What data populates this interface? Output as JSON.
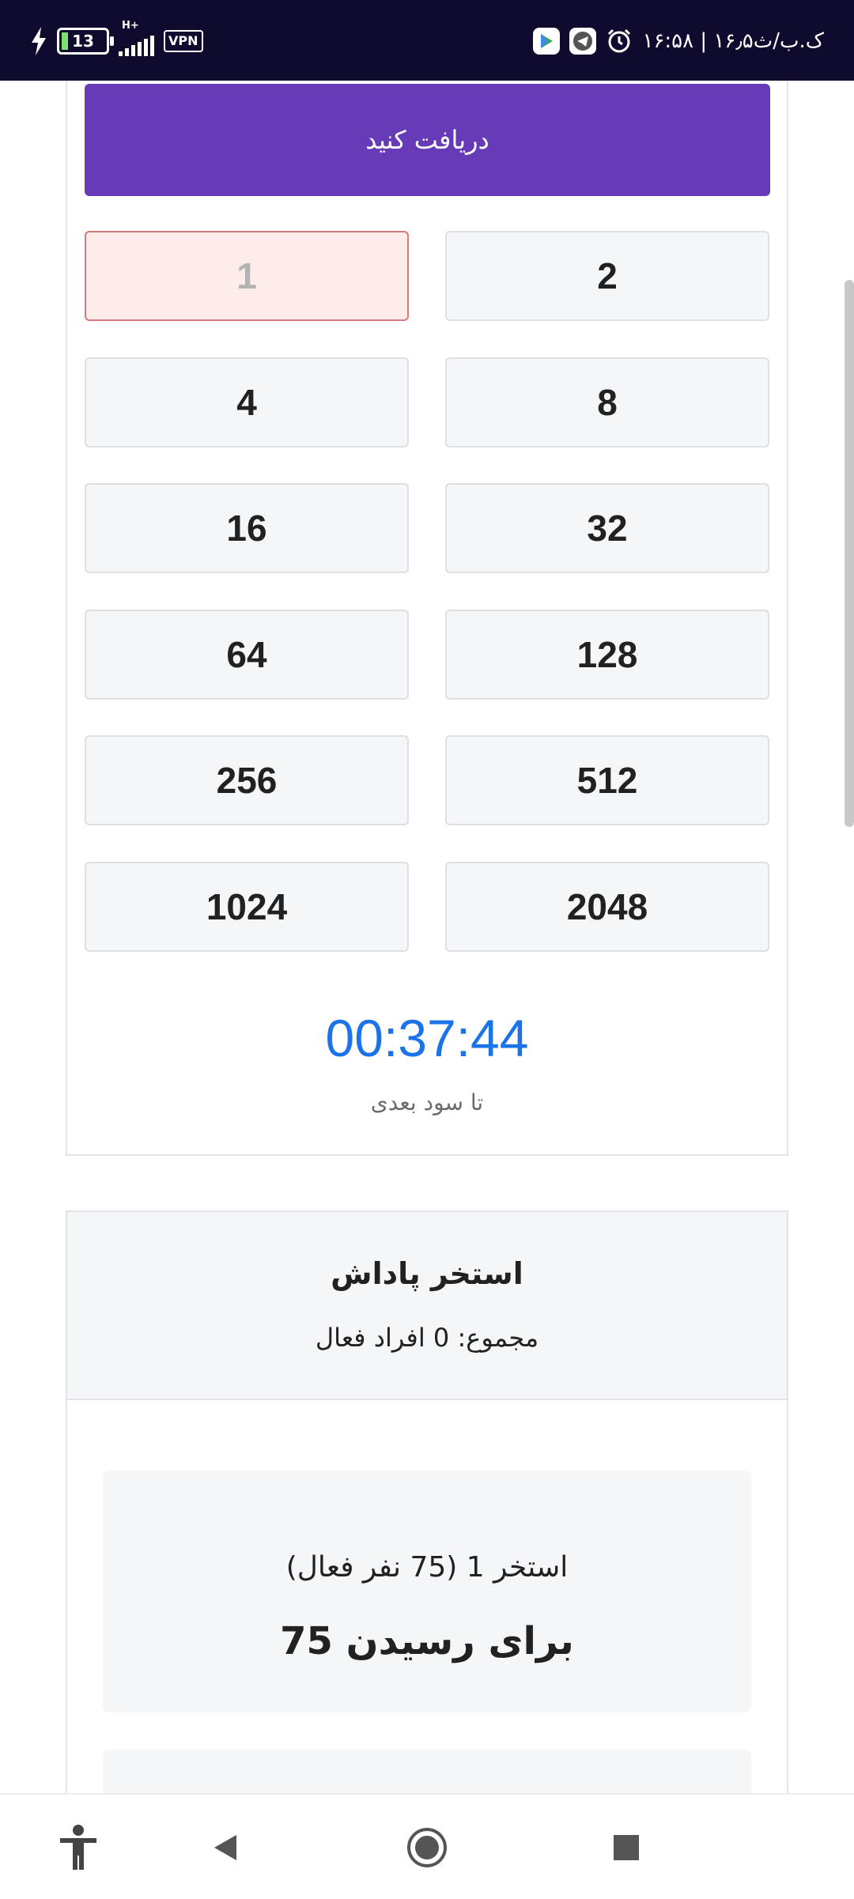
{
  "status_bar": {
    "time": "۱۶:۵۸ | ۱۶٫۵ک.ب/ث",
    "battery": "13",
    "network_type": "H+",
    "vpn_label": "VPN",
    "icons": [
      "charging-bolt-icon",
      "battery-icon",
      "signal-icon",
      "vpn-icon",
      "alarm-icon",
      "telegram-icon",
      "play-store-icon"
    ]
  },
  "receive_button": "دریافت کنید",
  "multipliers": [
    {
      "value": "1",
      "state": "disabled"
    },
    {
      "value": "2",
      "state": "enabled"
    },
    {
      "value": "4",
      "state": "enabled"
    },
    {
      "value": "8",
      "state": "enabled"
    },
    {
      "value": "16",
      "state": "enabled"
    },
    {
      "value": "32",
      "state": "enabled"
    },
    {
      "value": "64",
      "state": "enabled"
    },
    {
      "value": "128",
      "state": "enabled"
    },
    {
      "value": "256",
      "state": "enabled"
    },
    {
      "value": "512",
      "state": "enabled"
    },
    {
      "value": "1024",
      "state": "enabled"
    },
    {
      "value": "2048",
      "state": "enabled"
    }
  ],
  "timer": {
    "value": "00:37:44",
    "caption": "تا سود بعدی"
  },
  "reward_pool": {
    "title": "استخر پاداش",
    "total": "مجموع: 0 افراد فعال",
    "pools": [
      {
        "name": "استخر 1 (75 نفر فعال)",
        "goal": "برای رسیدن 75"
      }
    ]
  },
  "nav_bar": {
    "buttons": [
      "accessibility-icon",
      "back-icon",
      "home-icon",
      "recents-icon"
    ]
  },
  "colors": {
    "accent": "#673ab7",
    "timer": "#1a73e8",
    "status_bar": "#0f0b2e",
    "disabled_bg": "#feeceb",
    "disabled_border": "#d97a7a"
  }
}
